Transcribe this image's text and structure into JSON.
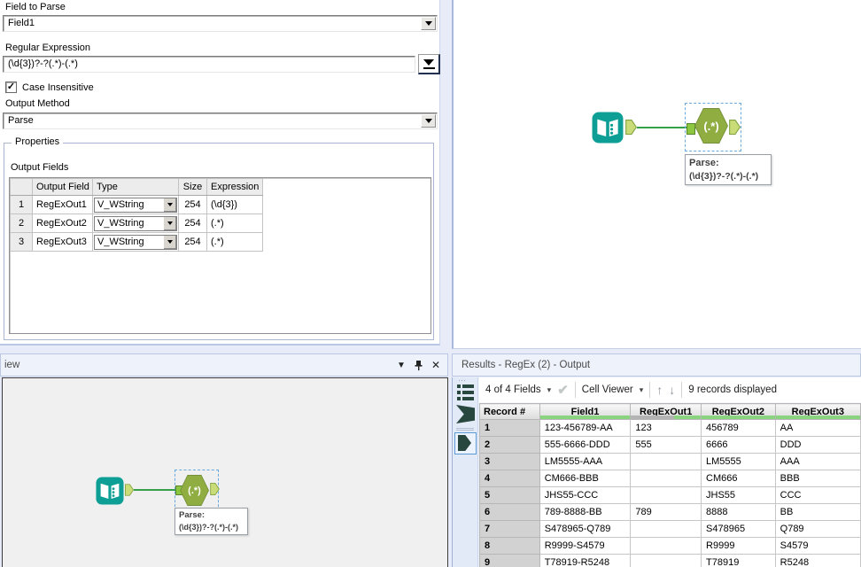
{
  "icons": {
    "dropdown_small": "▾",
    "dropdown_title": "▼",
    "check": "✔",
    "arrow_up": "↑",
    "arrow_down": "↓",
    "close": "✕",
    "checkbox_check": "✓",
    "drag_dots": "⋯"
  },
  "colors": {
    "accent_teal": "#0d9f96",
    "tool_olive": "#90ad41",
    "connection_green": "#35a048",
    "quality_ok_green": "#8bd47f",
    "quality_null_gray": "#b3b3b3",
    "selection_blue": "#69a8dc"
  },
  "config": {
    "field_to_parse_label": "Field to Parse",
    "field_to_parse_value": "Field1",
    "regex_label": "Regular Expression",
    "regex_value": "(\\d{3})?-?(.*)-(.*)",
    "case_insensitive_label": "Case Insensitive",
    "case_insensitive_checked": true,
    "output_method_label": "Output Method",
    "output_method_value": "Parse",
    "properties_label": "Properties",
    "output_fields_label": "Output Fields",
    "output_fields_table": {
      "headers": [
        "Output Field",
        "Type",
        "Size",
        "Expression"
      ],
      "rows": [
        {
          "num": "1",
          "field": "RegExOut1",
          "type": "V_WString",
          "size": "254",
          "expr": "(\\d{3})"
        },
        {
          "num": "2",
          "field": "RegExOut2",
          "type": "V_WString",
          "size": "254",
          "expr": "(.*)"
        },
        {
          "num": "3",
          "field": "RegExOut3",
          "type": "V_WString",
          "size": "254",
          "expr": "(.*)"
        }
      ]
    }
  },
  "canvas": {
    "regex_tool_label": "(.*)",
    "tooltip_title": "Parse:",
    "tooltip_text": "(\\d{3})?-?(.*)-(.*)"
  },
  "overview": {
    "title": "iew",
    "regex_tool_label": "(.*)",
    "tooltip_title": "Parse:",
    "tooltip_text": "(\\d{3})?-?(.*)-(.*)"
  },
  "results": {
    "title": "Results - RegEx (2) - Output",
    "toolbar": {
      "fields_selector": "4 of 4 Fields",
      "cell_viewer": "Cell Viewer",
      "records_displayed": "9 records displayed"
    },
    "table": {
      "headers": [
        "Record #",
        "Field1",
        "RegExOut1",
        "RegExOut2",
        "RegExOut3"
      ],
      "rows": [
        [
          "1",
          "123-456789-AA",
          "123",
          "456789",
          "AA"
        ],
        [
          "2",
          "555-6666-DDD",
          "555",
          "6666",
          "DDD"
        ],
        [
          "3",
          "LM5555-AAA",
          "",
          "LM5555",
          "AAA"
        ],
        [
          "4",
          "CM666-BBB",
          "",
          "CM666",
          "BBB"
        ],
        [
          "5",
          "JHS55-CCC",
          "",
          "JHS55",
          "CCC"
        ],
        [
          "6",
          "789-8888-BB",
          "789",
          "8888",
          "BB"
        ],
        [
          "7",
          "S478965-Q789",
          "",
          "S478965",
          "Q789"
        ],
        [
          "8",
          "R9999-S4579",
          "",
          "R9999",
          "S4579"
        ],
        [
          "9",
          "T78919-R5248",
          "",
          "T78919",
          "R5248"
        ]
      ]
    }
  }
}
